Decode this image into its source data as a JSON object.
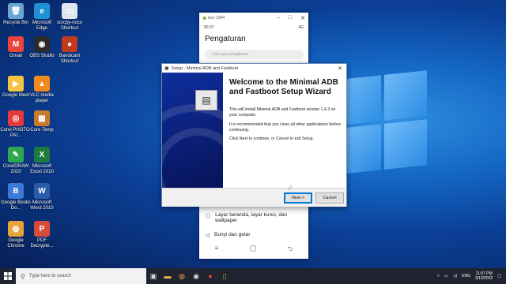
{
  "desktop_icons": [
    {
      "label": "Recycle Bin",
      "icon": "recycle-bin-icon",
      "color": "#6aa5d6",
      "glyph": "🗑"
    },
    {
      "label": "Microsoft Edge",
      "icon": "edge-icon",
      "color": "#1e90d6",
      "glyph": "e"
    },
    {
      "label": "scrcpy-noco Shortcut",
      "icon": "shortcut-icon",
      "color": "#dfe6ee",
      "glyph": "▭"
    },
    {
      "label": "Gmail",
      "icon": "gmail-icon",
      "color": "#e8453c",
      "glyph": "M"
    },
    {
      "label": "OBS Studio",
      "icon": "obs-icon",
      "color": "#2b2b2b",
      "glyph": "◉"
    },
    {
      "label": "Bandicam Shortcut",
      "icon": "bandicam-icon",
      "color": "#c23a1e",
      "glyph": "●"
    },
    {
      "label": "Google Meet",
      "icon": "meet-icon",
      "color": "#f4c542",
      "glyph": "▶"
    },
    {
      "label": "VLC media player",
      "icon": "vlc-icon",
      "color": "#f08a1c",
      "glyph": "▲"
    },
    {
      "label": "Corel PHOTO-PAI...",
      "icon": "corel-photo-icon",
      "color": "#e33b3b",
      "glyph": "◎"
    },
    {
      "label": "Core Temp",
      "icon": "core-temp-icon",
      "color": "#c97a2a",
      "glyph": "▦"
    },
    {
      "label": "CorelDRAW 2020",
      "icon": "coreldraw-icon",
      "color": "#2fa84f",
      "glyph": "✎"
    },
    {
      "label": "Microsoft Excel 2010",
      "icon": "excel-icon",
      "color": "#1f7a3e",
      "glyph": "X"
    },
    {
      "label": "Google Books Do...",
      "icon": "google-books-icon",
      "color": "#3b79d8",
      "glyph": "B"
    },
    {
      "label": "Microsoft Word 2010",
      "icon": "word-icon",
      "color": "#2b5caa",
      "glyph": "W"
    },
    {
      "label": "Google Chrome",
      "icon": "chrome-icon",
      "color": "#e8a33c",
      "glyph": "◍"
    },
    {
      "label": "PDF Decrypte...",
      "icon": "pdf-icon",
      "color": "#d94c3c",
      "glyph": "P"
    }
  ],
  "phone": {
    "window_title": "vivo 1904",
    "status_time": "00.07",
    "status_right": "4G",
    "page_title": "Pengaturan",
    "search_placeholder": "Cari opsi pengaturan",
    "rows": [
      {
        "label": "Layar beranda, layar kunci, dan wallpaper",
        "icon": "home-screen-icon"
      },
      {
        "label": "Bunyi dan getar",
        "icon": "sound-icon"
      }
    ]
  },
  "setup": {
    "window_title": "Setup - Minimal ADB and Fastboot",
    "heading": "Welcome to the Minimal ADB and Fastboot Setup Wizard",
    "para1": "This will install Minimal ADB and Fastboot version 1.4.3 on your computer.",
    "para2": "It is recommended that you close all other applications before continuing.",
    "para3": "Click Next to continue, or Cancel to exit Setup.",
    "next_label": "Next >",
    "cancel_label": "Cancel"
  },
  "taskbar": {
    "search_placeholder": "Type here to search",
    "language": "ENG",
    "time": "11:07 PM",
    "date": "3/13/2022"
  },
  "colors": {
    "accent": "#0078d7",
    "taskbar": "#1f2430",
    "setup_banner": "#0a1f78"
  }
}
